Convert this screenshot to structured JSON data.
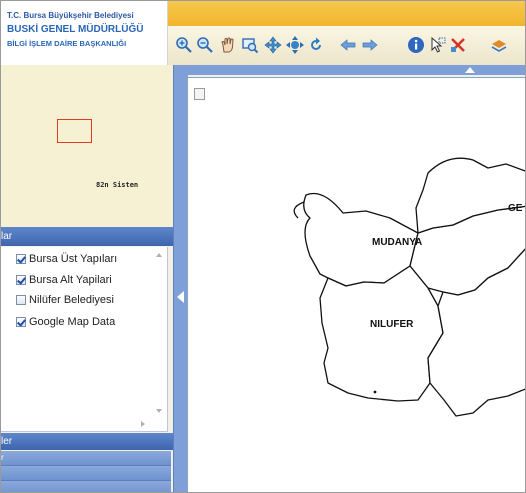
{
  "logo": {
    "line1": "T.C. Bursa Büyükşehir Belediyesi",
    "line2": "BUSKİ GENEL MÜDÜRLÜĞÜ",
    "line3": "BİLGİ İŞLEM DAİRE BAŞKANLIĞI"
  },
  "toolbar": {
    "buttons": [
      "zoom-in-icon",
      "zoom-out-icon",
      "pan-hand-icon",
      "zoom-extent-icon",
      "full-extent-icon",
      "move-icon",
      "refresh-icon",
      "back-arrow-icon",
      "forward-arrow-icon",
      "info-icon",
      "select-icon",
      "clear-icon",
      "layer-tool-icon"
    ]
  },
  "overview": {
    "scale_text": "82n Sisten",
    "extent_color": "#e23b25"
  },
  "layers": {
    "header": "lar",
    "items": [
      {
        "label": "Bursa Üst Yapıları",
        "checked": true
      },
      {
        "label": "Bursa Alt Yapilari",
        "checked": true
      },
      {
        "label": "Nilüfer Belediyesi",
        "checked": false
      },
      {
        "label": "Google Map Data",
        "checked": true
      }
    ]
  },
  "legend": {
    "header": "ler",
    "row1": "r",
    "row2": ""
  },
  "map": {
    "labels": {
      "mudanya": "MUDANYA",
      "nilufer": "NILUFER",
      "gemlik": "GE"
    }
  },
  "colors": {
    "accent": "#f1b52e",
    "panel_header": "#3f66ad",
    "splitter": "#7f9fd9"
  }
}
